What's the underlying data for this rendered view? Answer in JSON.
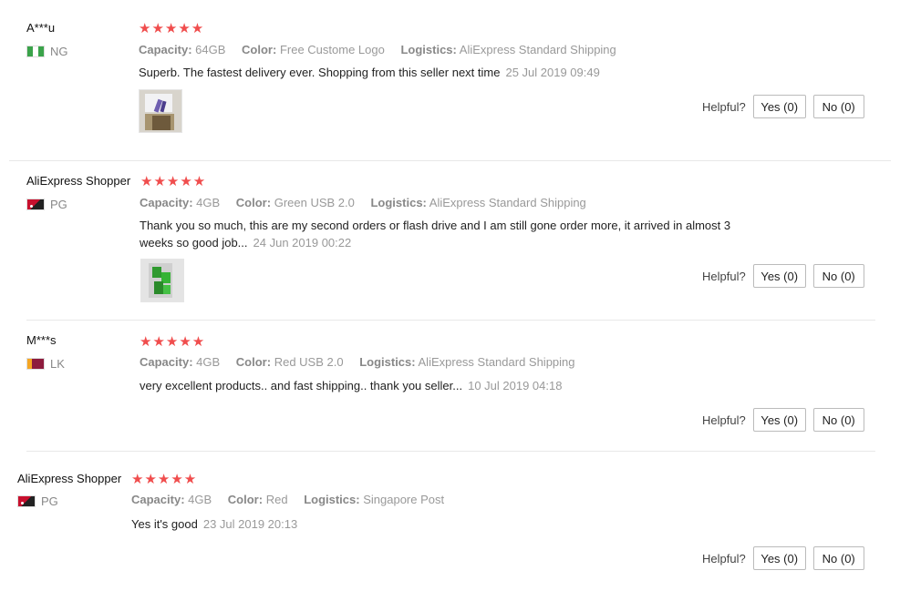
{
  "helpful_label": "Helpful?",
  "attribute_labels": {
    "capacity": "Capacity:",
    "color": "Color:",
    "logistics": "Logistics:"
  },
  "reviews": [
    {
      "name": "A***u",
      "country": "NG",
      "stars": "★★★★★",
      "capacity": "64GB",
      "color": "Free Custome Logo",
      "logistics": "AliExpress Standard Shipping",
      "text": "Superb. The fastest delivery ever. Shopping from this seller next time",
      "date": "25 Jul 2019 09:49",
      "yes": "Yes (0)",
      "no": "No (0)"
    },
    {
      "name": "AliExpress Shopper",
      "country": "PG",
      "stars": "★★★★★",
      "capacity": "4GB",
      "color": "Green USB 2.0",
      "logistics": "AliExpress Standard Shipping",
      "text": "Thank you so much, this are my second orders or flash drive and I am still gone order more, it arrived in almost 3 weeks so good job...",
      "date": "24 Jun 2019 00:22",
      "yes": "Yes (0)",
      "no": "No (0)"
    },
    {
      "name": "M***s",
      "country": "LK",
      "stars": "★★★★★",
      "capacity": "4GB",
      "color": "Red USB 2.0",
      "logistics": "AliExpress Standard Shipping",
      "text": "very excellent products.. and fast shipping.. thank you seller...",
      "date": "10 Jul 2019 04:18",
      "yes": "Yes (0)",
      "no": "No (0)"
    },
    {
      "name": "AliExpress Shopper",
      "country": "PG",
      "stars": "★★★★★",
      "capacity": "4GB",
      "color": "Red",
      "logistics": "Singapore Post",
      "text": "Yes it's good",
      "date": "23 Jul 2019 20:13",
      "yes": "Yes (0)",
      "no": "No (0)"
    }
  ]
}
